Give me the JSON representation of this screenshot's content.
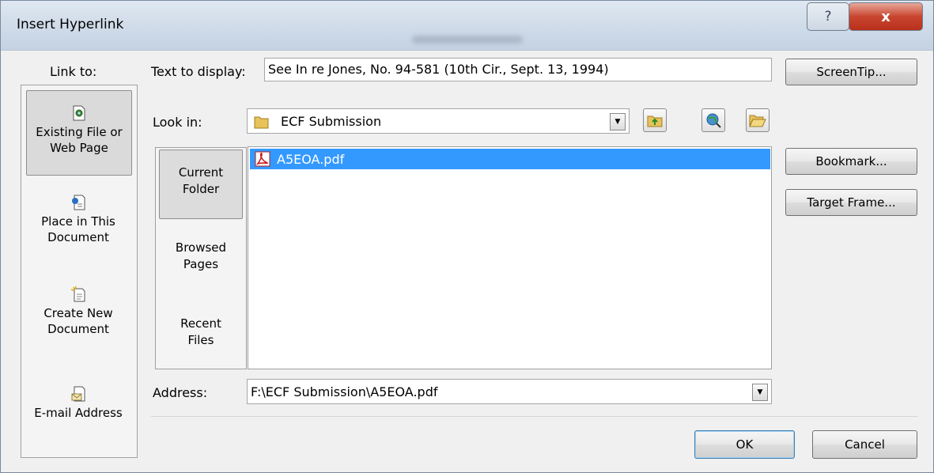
{
  "window": {
    "title": "Insert Hyperlink",
    "help_glyph": "?",
    "close_glyph": "x"
  },
  "link_to": {
    "label": "Link to:",
    "items": [
      {
        "line1": "Existing File or",
        "line2": "Web Page",
        "icon": "web-page-icon",
        "selected": true
      },
      {
        "line1": "Place in This",
        "line2": "Document",
        "icon": "document-place-icon",
        "selected": false
      },
      {
        "line1": "Create New",
        "line2": "Document",
        "icon": "new-document-icon",
        "selected": false
      },
      {
        "line1": "E-mail Address",
        "line2": "",
        "icon": "email-icon",
        "selected": false
      }
    ]
  },
  "text_to_display": {
    "label": "Text to display:",
    "value": "See In re Jones, No. 94-581 (10th Cir., Sept. 13, 1994)"
  },
  "buttons": {
    "screentip": "ScreenTip...",
    "bookmark": "Bookmark...",
    "target_frame": "Target Frame...",
    "ok": "OK",
    "cancel": "Cancel"
  },
  "look_in": {
    "label": "Look in:",
    "value": "ECF Submission"
  },
  "places": [
    {
      "line1": "Current",
      "line2": "Folder",
      "selected": true
    },
    {
      "line1": "Browsed",
      "line2": "Pages",
      "selected": false
    },
    {
      "line1": "Recent",
      "line2": "Files",
      "selected": false
    }
  ],
  "files": [
    {
      "name": "A5EOA.pdf",
      "selected": true
    }
  ],
  "address": {
    "label": "Address:",
    "value": "F:\\ECF Submission\\A5EOA.pdf"
  },
  "colors": {
    "selection": "#3399ff",
    "close_red": "#c8452f"
  }
}
